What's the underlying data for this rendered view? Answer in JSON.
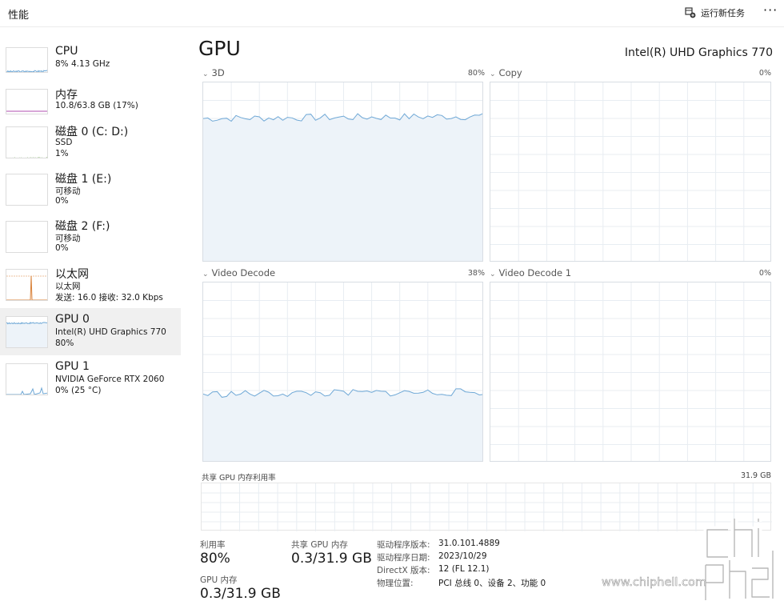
{
  "header": {
    "title": "性能",
    "run_task_label": "运行新任务",
    "more_label": "···"
  },
  "sidebar": {
    "items": [
      {
        "name": "CPU",
        "sub1": "8% 4.13 GHz",
        "sub2": ""
      },
      {
        "name": "内存",
        "sub1": "10.8/63.8 GB (17%)",
        "sub2": ""
      },
      {
        "name": "磁盘 0 (C: D:)",
        "sub1": "SSD",
        "sub2": "1%"
      },
      {
        "name": "磁盘 1 (E:)",
        "sub1": "可移动",
        "sub2": "0%"
      },
      {
        "name": "磁盘 2 (F:)",
        "sub1": "可移动",
        "sub2": "0%"
      },
      {
        "name": "以太网",
        "sub1": "以太网",
        "sub2": "发送: 16.0 接收: 32.0 Kbps"
      },
      {
        "name": "GPU 0",
        "sub1": "Intel(R) UHD Graphics 770",
        "sub2": "80%"
      },
      {
        "name": "GPU 1",
        "sub1": "NVIDIA GeForce RTX 2060",
        "sub2": "0% (25 °C)"
      }
    ]
  },
  "main": {
    "title": "GPU",
    "model": "Intel(R) UHD Graphics 770",
    "engines": [
      {
        "label": "3D",
        "percent": "80%",
        "level": 0.8
      },
      {
        "label": "Copy",
        "percent": "0%",
        "level": 0
      },
      {
        "label": "Video Decode",
        "percent": "38%",
        "level": 0.38
      },
      {
        "label": "Video Decode 1",
        "percent": "0%",
        "level": 0
      }
    ],
    "shared_memory": {
      "label": "共享 GPU 内存利用率",
      "total": "31.9 GB"
    },
    "stats": {
      "utilization_label": "利用率",
      "utilization_value": "80%",
      "shared_mem_label": "共享 GPU 内存",
      "shared_mem_value": "0.3/31.9 GB",
      "gpu_mem_label": "GPU 内存",
      "gpu_mem_value": "0.3/31.9 GB"
    },
    "info": [
      {
        "key": "驱动程序版本:",
        "value": "31.0.101.4889"
      },
      {
        "key": "驱动程序日期:",
        "value": "2023/10/29"
      },
      {
        "key": "DirectX 版本:",
        "value": "12 (FL 12.1)"
      },
      {
        "key": "物理位置:",
        "value": "PCI 总线 0、设备 2、功能 0"
      }
    ]
  },
  "colors": {
    "accent_line": "#6fa8d6",
    "accent_fill": "#edf3f9",
    "memory_line": "#b04fb0",
    "disk_line": "#77b255",
    "ethernet_line": "#d9823a",
    "grid": "#e8edf2"
  },
  "watermark": {
    "logo_text": "chip hell",
    "url": "www.chiphell.com"
  }
}
